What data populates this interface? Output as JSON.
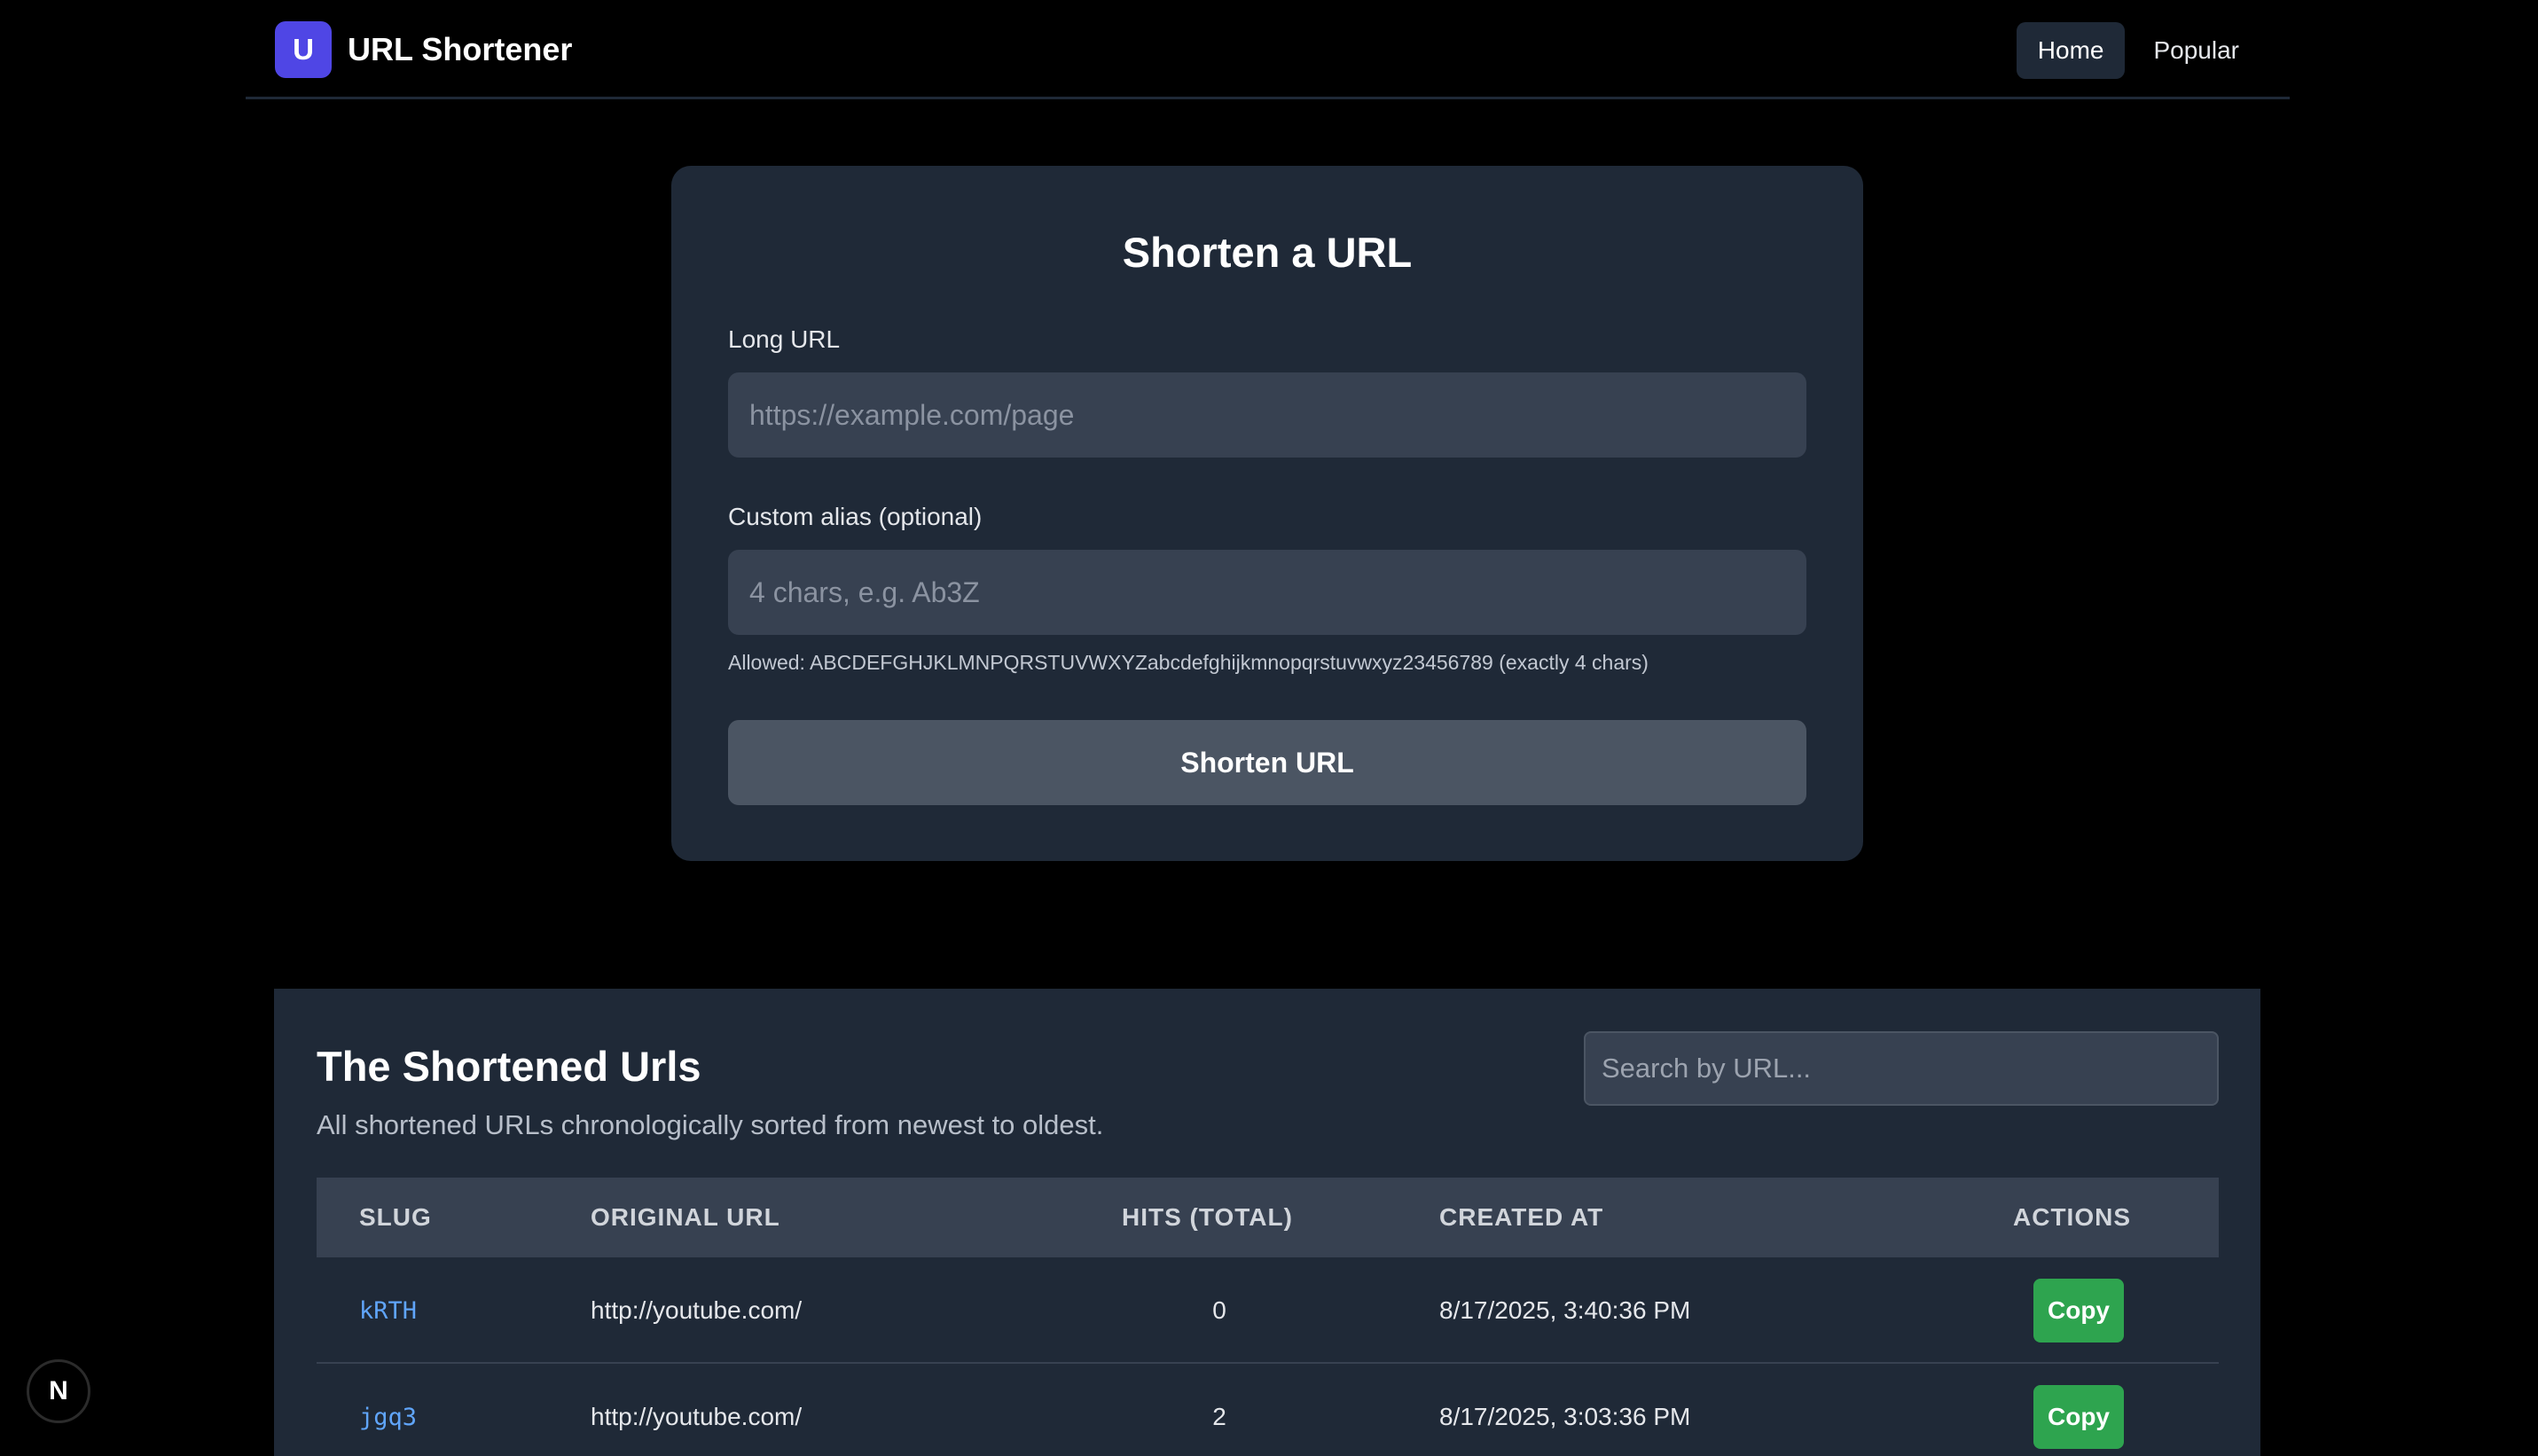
{
  "nav": {
    "logo_letter": "U",
    "app_name": "URL Shortener",
    "links": [
      {
        "label": "Home",
        "active": true
      },
      {
        "label": "Popular",
        "active": false
      }
    ]
  },
  "form": {
    "title": "Shorten a URL",
    "long_url_label": "Long URL",
    "long_url_placeholder": "https://example.com/page",
    "alias_label": "Custom alias (optional)",
    "alias_placeholder": "4 chars, e.g. Ab3Z",
    "helper": "Allowed: ABCDEFGHJKLMNPQRSTUVWXYZabcdefghijkmnopqrstuvwxyz23456789 (exactly 4 chars)",
    "submit_label": "Shorten URL"
  },
  "table_section": {
    "title": "The Shortened Urls",
    "subtitle": "All shortened URLs chronologically sorted from newest to oldest.",
    "search_placeholder": "Search by URL...",
    "columns": [
      "SLUG",
      "ORIGINAL URL",
      "HITS (TOTAL)",
      "CREATED AT",
      "ACTIONS"
    ],
    "rows": [
      {
        "slug": "kRTH",
        "url": "http://youtube.com/",
        "hits": "0",
        "created": "8/17/2025, 3:40:36 PM",
        "action": "Copy"
      },
      {
        "slug": "jgq3",
        "url": "http://youtube.com/",
        "hits": "2",
        "created": "8/17/2025, 3:03:36 PM",
        "action": "Copy"
      }
    ]
  },
  "badge": {
    "label": "N"
  },
  "colors": {
    "background": "#000000",
    "card": "#1f2937",
    "input": "#374151",
    "brand": "#4f46e5",
    "copy_button": "#2ea44f",
    "slug_link": "#60a5fa"
  }
}
